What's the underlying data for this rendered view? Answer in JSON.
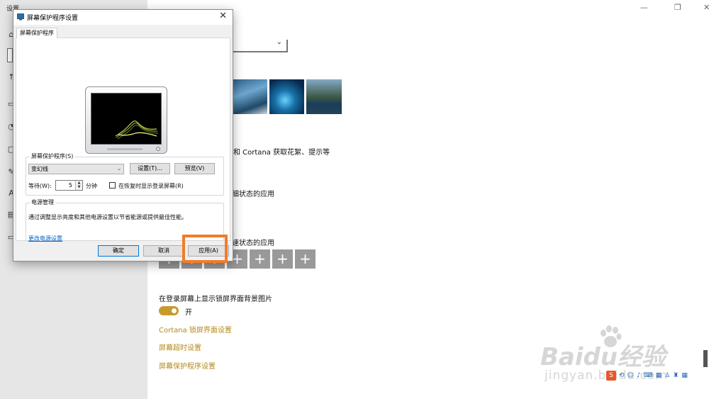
{
  "settings": {
    "title": "设置",
    "text_cortana": "和 Cortana 获取花絮、提示等",
    "text_detail_app": "细状态的应用",
    "text_quick_app": "速状态的应用",
    "lock_bg_label": "在登录屏幕上显示锁屏界面背景图片",
    "toggle_state": "开",
    "link_cortana": "Cortana 锁屏界面设置",
    "link_timeout": "屏幕超时设置",
    "link_screensaver": "屏幕保护程序设置",
    "add_button_label": "+",
    "brand_color": "#c69a2c"
  },
  "dialog": {
    "title": "屏幕保护程序设置",
    "tab": "屏幕保护程序",
    "screensaver_group": {
      "legend": "屏幕保护程序(S)",
      "selected": "变幻线",
      "settings_btn": "设置(T)...",
      "preview_btn": "预览(V)",
      "wait_label": "等待(W):",
      "wait_value": "5",
      "wait_unit": "分钟",
      "resume_label": "在恢复时显示登录屏幕(R)"
    },
    "power_group": {
      "legend": "电源管理",
      "description": "通过调整显示亮度和其他电源设置以节省能源或提供最佳性能。",
      "link": "更改电源设置"
    },
    "buttons": {
      "ok": "确定",
      "cancel": "取消",
      "apply": "应用(A)"
    },
    "highlight_color": "#f07d2a"
  },
  "watermark": {
    "main": "Baidu经验",
    "sub": "jingyan.baidu.com"
  },
  "tray": {
    "ime": "S"
  }
}
